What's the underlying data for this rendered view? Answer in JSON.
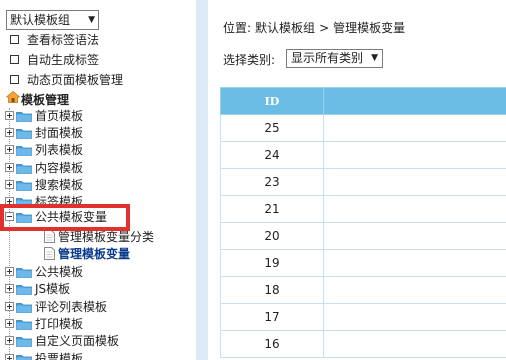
{
  "left": {
    "group_select": "默认模板组",
    "links": [
      "查看标签语法",
      "自动生成标签",
      "动态页面模板管理"
    ],
    "tree_root": "模板管理",
    "folders_top": [
      "首页模板",
      "封面模板",
      "列表模板",
      "内容模板",
      "搜索模板",
      "标签模板"
    ],
    "expanded_folder": "公共模板变量",
    "children": [
      {
        "label": "管理模板变量分类"
      },
      {
        "label": "管理模板变量"
      }
    ],
    "folders_bottom": [
      "公共模板",
      "JS模板",
      "评论列表模板",
      "打印模板",
      "自定义页面模板",
      "投票模板"
    ]
  },
  "right": {
    "breadcrumb": [
      "位置:",
      "默认模板组",
      ">",
      "管理模板变量"
    ],
    "category_label": "选择类别:",
    "category_value": "显示所有类别",
    "table": {
      "columns": [
        "ID",
        ""
      ],
      "rows": [
        "25",
        "24",
        "23",
        "21",
        "20",
        "19",
        "18",
        "17",
        "16"
      ]
    }
  },
  "colors": {
    "header_blue": "#6cbde6",
    "divider": "#dbeaf6",
    "highlight_red": "#e0312d",
    "active_link": "#0b3a8c"
  },
  "icons": [
    "checkbox-icon",
    "home-icon",
    "folder-icon",
    "document-icon",
    "expand-plus-icon",
    "collapse-minus-icon",
    "dropdown-arrow-icon"
  ]
}
